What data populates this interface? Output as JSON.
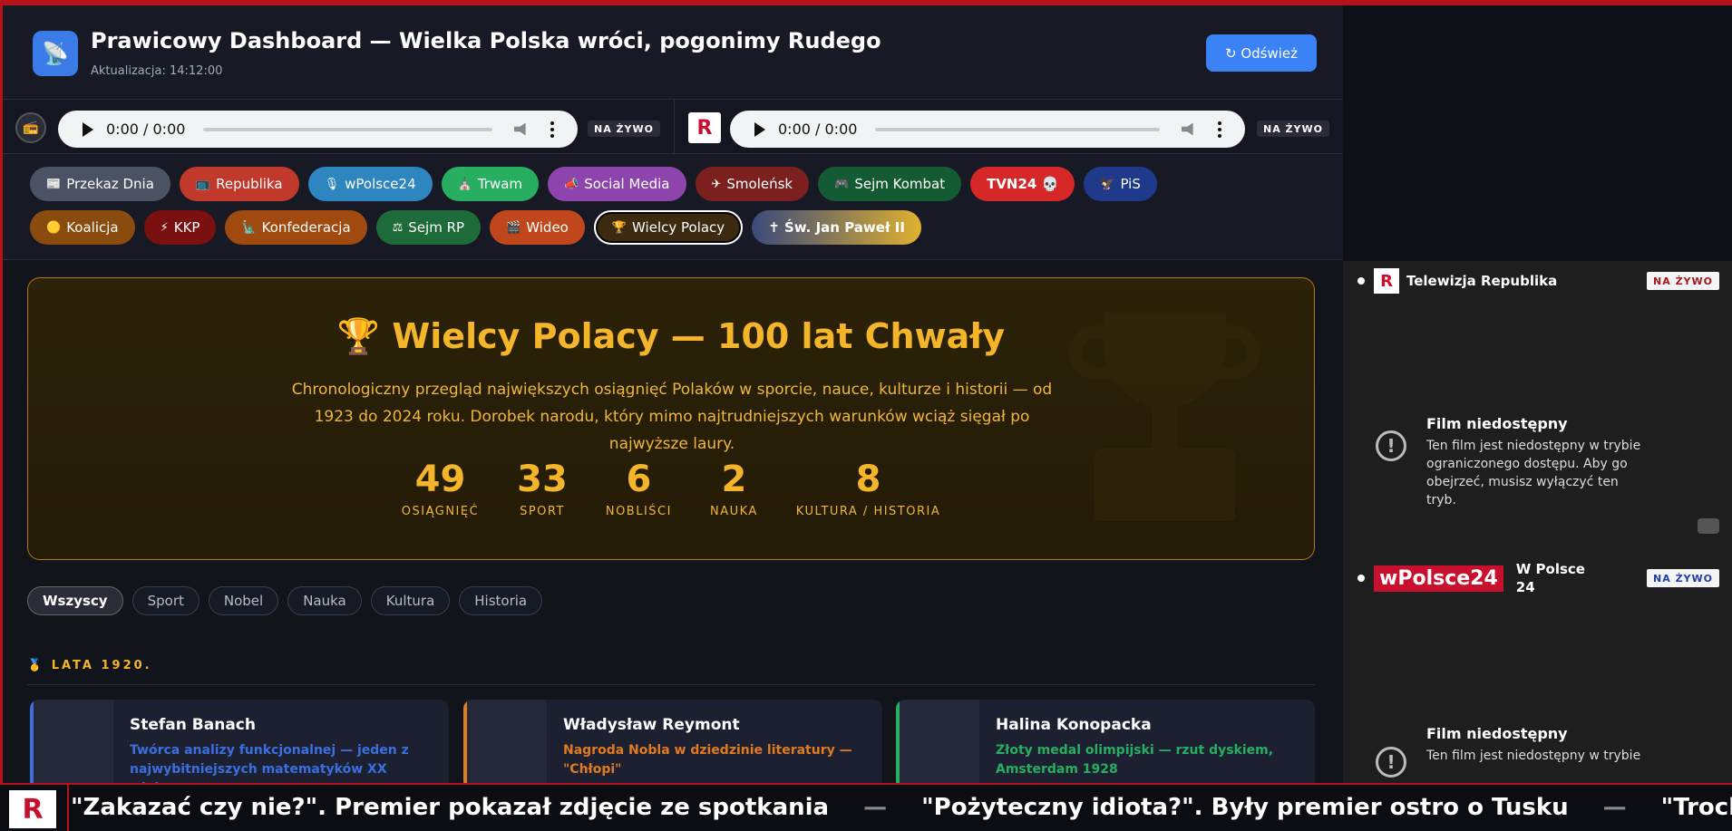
{
  "header": {
    "title": "Prawicowy Dashboard — Wielka Polska wróci, pogonimy Rudego",
    "updated": "Aktualizacja: 14:12:00",
    "refresh_label": "↻ Odśwież"
  },
  "radio": {
    "player1_time": "0:00 / 0:00",
    "player2_time": "0:00 / 0:00",
    "live1": "NA ŻYWO",
    "live2": "NA ŻYWO",
    "logo2": "R"
  },
  "nav": {
    "row1": [
      {
        "label": "Przekaz Dnia",
        "icon": "📰",
        "color": "#4b5263"
      },
      {
        "label": "Republika",
        "icon": "📺",
        "color": "#c0392b"
      },
      {
        "label": "wPolsce24",
        "icon": "🎙",
        "color": "#2e86c1"
      },
      {
        "label": "Trwam",
        "icon": "⛪",
        "color": "#27ae60"
      },
      {
        "label": "Social Media",
        "icon": "📣",
        "color": "#8e44ad"
      },
      {
        "label": "Smoleńsk",
        "icon": "✈",
        "color": "#7b1f1f"
      },
      {
        "label": "Sejm Kombat",
        "icon": "🎮",
        "color": "#145a32"
      },
      {
        "label": "TVN24 💀",
        "icon": "💀",
        "color": "#d62828"
      },
      {
        "label": "PiS",
        "icon": "🦅",
        "color": "#1f3a8a"
      }
    ],
    "row2": [
      {
        "label": "Koalicja",
        "icon": "🟡",
        "color": "#8a4b0f"
      },
      {
        "label": "KKP",
        "icon": "⚡",
        "color": "#7a1010"
      },
      {
        "label": "Konfederacja",
        "icon": "🗽",
        "color": "#a04a10"
      },
      {
        "label": "Sejm RP",
        "icon": "⚖",
        "color": "#1e6b3a"
      },
      {
        "label": "Wideo",
        "icon": "🎬",
        "color": "#c0471b"
      },
      {
        "label": "Wielcy Polacy",
        "icon": "🏆",
        "color": "#3b2a10"
      },
      {
        "label": "✝ Św. Jan Paweł II",
        "icon": "",
        "color": "#3a4a7a"
      }
    ]
  },
  "hero": {
    "title": "🏆  Wielcy Polacy — 100 lat Chwały",
    "description": "Chronologiczny przegląd największych osiągnięć Polaków w sporcie, nauce, kulturze i historii — od 1923 do 2024 roku. Dorobek narodu, który mimo najtrudniejszych warunków wciąż sięgał po najwyższe laury.",
    "stats": [
      {
        "num": "49",
        "label": "OSIĄGNIĘĆ"
      },
      {
        "num": "33",
        "label": "SPORT"
      },
      {
        "num": "6",
        "label": "NOBLIŚCI"
      },
      {
        "num": "2",
        "label": "NAUKA"
      },
      {
        "num": "8",
        "label": "KULTURA / HISTORIA"
      }
    ]
  },
  "filters": [
    "Wszyscy",
    "Sport",
    "Nobel",
    "Nauka",
    "Kultura",
    "Historia"
  ],
  "section": {
    "label": "🥇 LATA 1920."
  },
  "cards": [
    {
      "name": "Stefan Banach",
      "desc": "Twórca analizy funkcjonalnej — jeden z najwybitniejszych matematyków XX wieku",
      "color": "#3b6fe0"
    },
    {
      "name": "Władysław Reymont",
      "desc": "Nagroda Nobla w dziedzinie literatury — \"Chłopi\"",
      "color": "#e07b1f"
    },
    {
      "name": "Halina Konopacka",
      "desc": "Złoty medal olimpijski — rzut dyskiem, Amsterdam 1928",
      "color": "#27ae60"
    }
  ],
  "sidebar": {
    "ch1": {
      "name": "Telewizja Republika",
      "badge": "NA ŻYWO",
      "color": "#a01a1f"
    },
    "ch2": {
      "name": "W Polsce 24",
      "badge": "NA ŻYWO",
      "color": "#1e3fa8",
      "logo": "wPolsce24"
    },
    "unavailable_title": "Film niedostępny",
    "unavailable_desc": "Ten film jest niedostępny w trybie ograniczonego dostępu. Aby go obejrzeć, musisz wyłączyć ten tryb.",
    "unavailable_desc2": "Ten film jest niedostępny w trybie"
  },
  "ticker": {
    "logo": "R",
    "items": [
      "\"Zakazać czy nie?\". Premier pokazał zdjęcie ze spotkania",
      "\"Pożyteczny idiota?\". Były premier ostro o Tusku",
      "\"Trochę żenując"
    ],
    "separator": "—"
  }
}
